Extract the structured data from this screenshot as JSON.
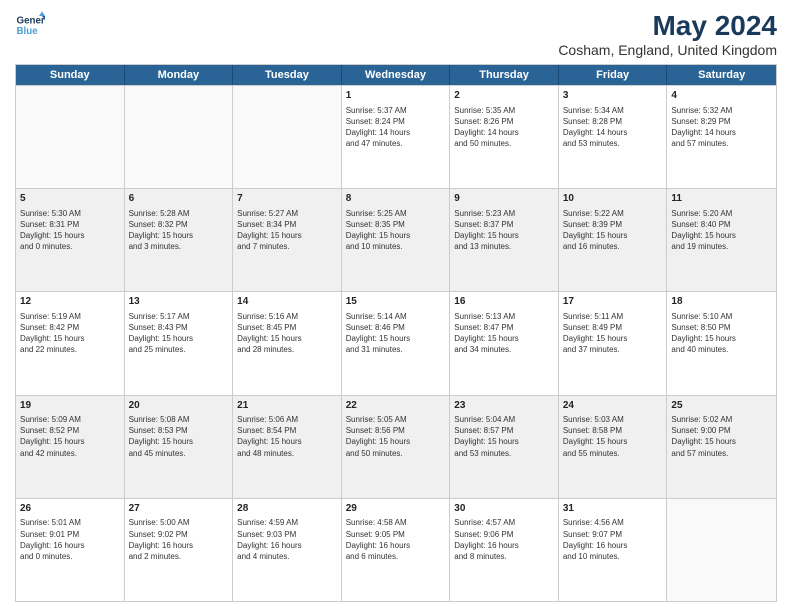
{
  "logo": {
    "line1": "General",
    "line2": "Blue"
  },
  "title": "May 2024",
  "subtitle": "Cosham, England, United Kingdom",
  "days": [
    "Sunday",
    "Monday",
    "Tuesday",
    "Wednesday",
    "Thursday",
    "Friday",
    "Saturday"
  ],
  "weeks": [
    [
      {
        "day": "",
        "content": ""
      },
      {
        "day": "",
        "content": ""
      },
      {
        "day": "",
        "content": ""
      },
      {
        "day": "1",
        "content": "Sunrise: 5:37 AM\nSunset: 8:24 PM\nDaylight: 14 hours\nand 47 minutes."
      },
      {
        "day": "2",
        "content": "Sunrise: 5:35 AM\nSunset: 8:26 PM\nDaylight: 14 hours\nand 50 minutes."
      },
      {
        "day": "3",
        "content": "Sunrise: 5:34 AM\nSunset: 8:28 PM\nDaylight: 14 hours\nand 53 minutes."
      },
      {
        "day": "4",
        "content": "Sunrise: 5:32 AM\nSunset: 8:29 PM\nDaylight: 14 hours\nand 57 minutes."
      }
    ],
    [
      {
        "day": "5",
        "content": "Sunrise: 5:30 AM\nSunset: 8:31 PM\nDaylight: 15 hours\nand 0 minutes."
      },
      {
        "day": "6",
        "content": "Sunrise: 5:28 AM\nSunset: 8:32 PM\nDaylight: 15 hours\nand 3 minutes."
      },
      {
        "day": "7",
        "content": "Sunrise: 5:27 AM\nSunset: 8:34 PM\nDaylight: 15 hours\nand 7 minutes."
      },
      {
        "day": "8",
        "content": "Sunrise: 5:25 AM\nSunset: 8:35 PM\nDaylight: 15 hours\nand 10 minutes."
      },
      {
        "day": "9",
        "content": "Sunrise: 5:23 AM\nSunset: 8:37 PM\nDaylight: 15 hours\nand 13 minutes."
      },
      {
        "day": "10",
        "content": "Sunrise: 5:22 AM\nSunset: 8:39 PM\nDaylight: 15 hours\nand 16 minutes."
      },
      {
        "day": "11",
        "content": "Sunrise: 5:20 AM\nSunset: 8:40 PM\nDaylight: 15 hours\nand 19 minutes."
      }
    ],
    [
      {
        "day": "12",
        "content": "Sunrise: 5:19 AM\nSunset: 8:42 PM\nDaylight: 15 hours\nand 22 minutes."
      },
      {
        "day": "13",
        "content": "Sunrise: 5:17 AM\nSunset: 8:43 PM\nDaylight: 15 hours\nand 25 minutes."
      },
      {
        "day": "14",
        "content": "Sunrise: 5:16 AM\nSunset: 8:45 PM\nDaylight: 15 hours\nand 28 minutes."
      },
      {
        "day": "15",
        "content": "Sunrise: 5:14 AM\nSunset: 8:46 PM\nDaylight: 15 hours\nand 31 minutes."
      },
      {
        "day": "16",
        "content": "Sunrise: 5:13 AM\nSunset: 8:47 PM\nDaylight: 15 hours\nand 34 minutes."
      },
      {
        "day": "17",
        "content": "Sunrise: 5:11 AM\nSunset: 8:49 PM\nDaylight: 15 hours\nand 37 minutes."
      },
      {
        "day": "18",
        "content": "Sunrise: 5:10 AM\nSunset: 8:50 PM\nDaylight: 15 hours\nand 40 minutes."
      }
    ],
    [
      {
        "day": "19",
        "content": "Sunrise: 5:09 AM\nSunset: 8:52 PM\nDaylight: 15 hours\nand 42 minutes."
      },
      {
        "day": "20",
        "content": "Sunrise: 5:08 AM\nSunset: 8:53 PM\nDaylight: 15 hours\nand 45 minutes."
      },
      {
        "day": "21",
        "content": "Sunrise: 5:06 AM\nSunset: 8:54 PM\nDaylight: 15 hours\nand 48 minutes."
      },
      {
        "day": "22",
        "content": "Sunrise: 5:05 AM\nSunset: 8:56 PM\nDaylight: 15 hours\nand 50 minutes."
      },
      {
        "day": "23",
        "content": "Sunrise: 5:04 AM\nSunset: 8:57 PM\nDaylight: 15 hours\nand 53 minutes."
      },
      {
        "day": "24",
        "content": "Sunrise: 5:03 AM\nSunset: 8:58 PM\nDaylight: 15 hours\nand 55 minutes."
      },
      {
        "day": "25",
        "content": "Sunrise: 5:02 AM\nSunset: 9:00 PM\nDaylight: 15 hours\nand 57 minutes."
      }
    ],
    [
      {
        "day": "26",
        "content": "Sunrise: 5:01 AM\nSunset: 9:01 PM\nDaylight: 16 hours\nand 0 minutes."
      },
      {
        "day": "27",
        "content": "Sunrise: 5:00 AM\nSunset: 9:02 PM\nDaylight: 16 hours\nand 2 minutes."
      },
      {
        "day": "28",
        "content": "Sunrise: 4:59 AM\nSunset: 9:03 PM\nDaylight: 16 hours\nand 4 minutes."
      },
      {
        "day": "29",
        "content": "Sunrise: 4:58 AM\nSunset: 9:05 PM\nDaylight: 16 hours\nand 6 minutes."
      },
      {
        "day": "30",
        "content": "Sunrise: 4:57 AM\nSunset: 9:06 PM\nDaylight: 16 hours\nand 8 minutes."
      },
      {
        "day": "31",
        "content": "Sunrise: 4:56 AM\nSunset: 9:07 PM\nDaylight: 16 hours\nand 10 minutes."
      },
      {
        "day": "",
        "content": ""
      }
    ]
  ]
}
